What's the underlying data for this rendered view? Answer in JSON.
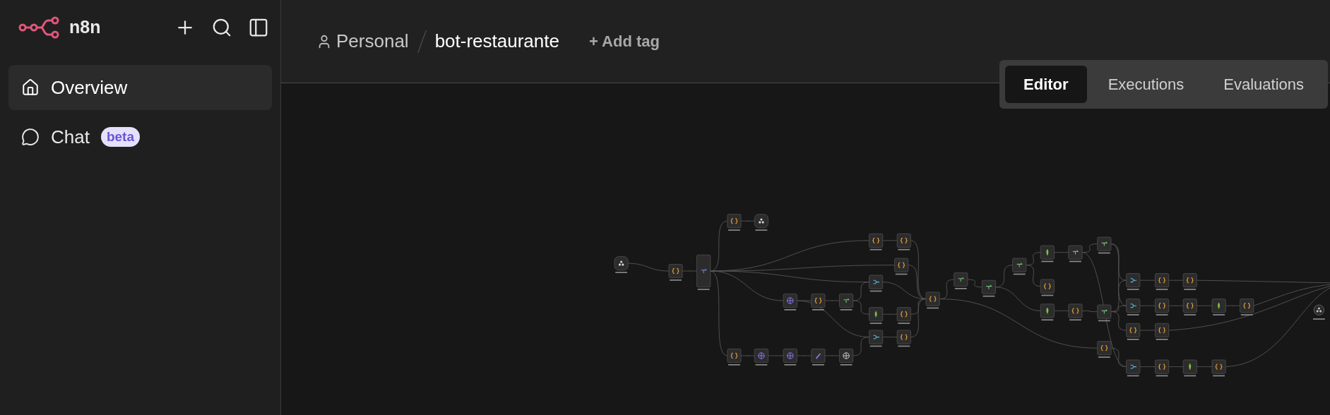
{
  "app": {
    "name": "n8n"
  },
  "sidebar": {
    "items": [
      {
        "kind": "home",
        "label": "Overview",
        "selected": true
      },
      {
        "kind": "chat",
        "label": "Chat",
        "badge": "beta",
        "selected": false
      }
    ]
  },
  "header": {
    "breadcrumb": {
      "project": "Personal",
      "workflow": "bot-restaurante"
    },
    "add_tag": "+ Add tag"
  },
  "tabs": [
    {
      "label": "Editor",
      "selected": true
    },
    {
      "label": "Executions",
      "selected": false
    },
    {
      "label": "Evaluations",
      "selected": false
    }
  ]
}
